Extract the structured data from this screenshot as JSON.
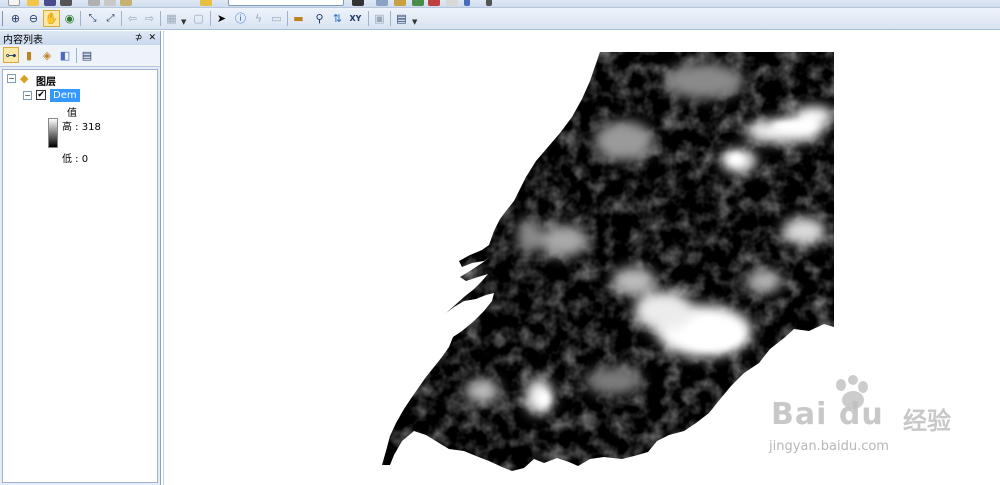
{
  "toc": {
    "title": "内容列表",
    "pin_label": "⊅",
    "close_label": "✕"
  },
  "tree": {
    "root_label": "图层",
    "layer_label": "Dem",
    "layer_checked": true,
    "legend_field": "值",
    "legend_high": "高 : 318",
    "legend_low": "低 : 0"
  },
  "watermark": {
    "brand": "Bai du",
    "suffix": "经验",
    "url": "jingyan.baidu.com"
  },
  "colors": {
    "selection": "#3399ff",
    "panel_bg": "#e4ecf7",
    "toolbar_bg": "#d8e3f1"
  }
}
